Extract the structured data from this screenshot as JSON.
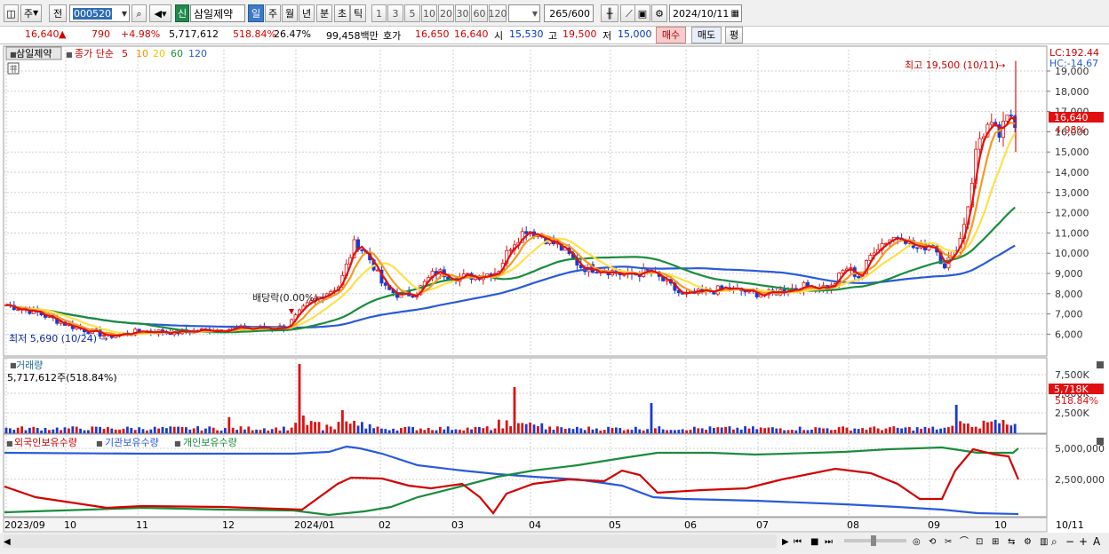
{
  "toolbar": {
    "mode_btn": "주",
    "prev_btn": "전",
    "code": "000520",
    "badge": "신",
    "stock_name": "삼일제약",
    "periods": [
      "일",
      "주",
      "월",
      "년",
      "분",
      "초",
      "틱"
    ],
    "active_period": "일",
    "mins": [
      "1",
      "3",
      "5",
      "10",
      "20",
      "30",
      "60",
      "120"
    ],
    "count": "265",
    "total": "/600",
    "date": "2024/10/11"
  },
  "info": {
    "price": "16,640",
    "arrow": "▲",
    "change": "790",
    "change_pct": "+4.98%",
    "volume": "5,717,612",
    "volume_ratio": "518.84%",
    "turnover": "26.47%",
    "amount": "99,458백만",
    "quote_label": "호가",
    "ask": "16,650",
    "bid": "16,640",
    "open_label": "시",
    "open": "15,530",
    "high_label": "고",
    "high": "19,500",
    "low_label": "저",
    "low": "15,000",
    "buy_btn": "매수",
    "sell_btn": "매도",
    "avg_btn": "평"
  },
  "price_panel": {
    "name_tag": "삼일제약",
    "legend_prefix": "종가 단순",
    "ma_labels": [
      {
        "text": "5",
        "color": "#dd0000"
      },
      {
        "text": "10",
        "color": "#ff8c00"
      },
      {
        "text": "20",
        "color": "#e8c800"
      },
      {
        "text": "60",
        "color": "#1a8c3c"
      },
      {
        "text": "120",
        "color": "#2a5ad8"
      }
    ],
    "lc": "LC:192.44",
    "hc": "HC:-14.67",
    "cur_price_tag": "16,640",
    "cur_pct_tag": "4.98%",
    "high_annot": "최고 19,500 (10/11)",
    "low_annot": "최저 5,690 (10/24)",
    "div_annot": "배당락(0.00%)",
    "y_ticks": [
      "19,000",
      "18,000",
      "17,000",
      "16,000",
      "15,000",
      "14,000",
      "13,000",
      "12,000",
      "11,000",
      "10,000",
      "9,000",
      "8,000",
      "7,000",
      "6,000"
    ]
  },
  "volume_panel": {
    "title": "거래량",
    "value": "5,717,612주(518.84%)",
    "tag1": "5,718K",
    "tag2": "518.84%",
    "y_ticks": [
      "7,500K",
      "5,000K",
      "2,500K"
    ]
  },
  "holding_panel": {
    "legend": [
      {
        "text": "외국인보유수량",
        "color": "#cc0000"
      },
      {
        "text": "기관보유수량",
        "color": "#2a5ad8"
      },
      {
        "text": "개인보유수량",
        "color": "#1a8c3c"
      }
    ],
    "y_ticks": [
      "5,000,000",
      "2,500,000"
    ]
  },
  "x_axis": {
    "labels": [
      "2023/09",
      "10",
      "11",
      "12",
      "2024/01",
      "02",
      "03",
      "04",
      "05",
      "06",
      "07",
      "08",
      "09",
      "10"
    ],
    "right_label": "10/11"
  }
}
